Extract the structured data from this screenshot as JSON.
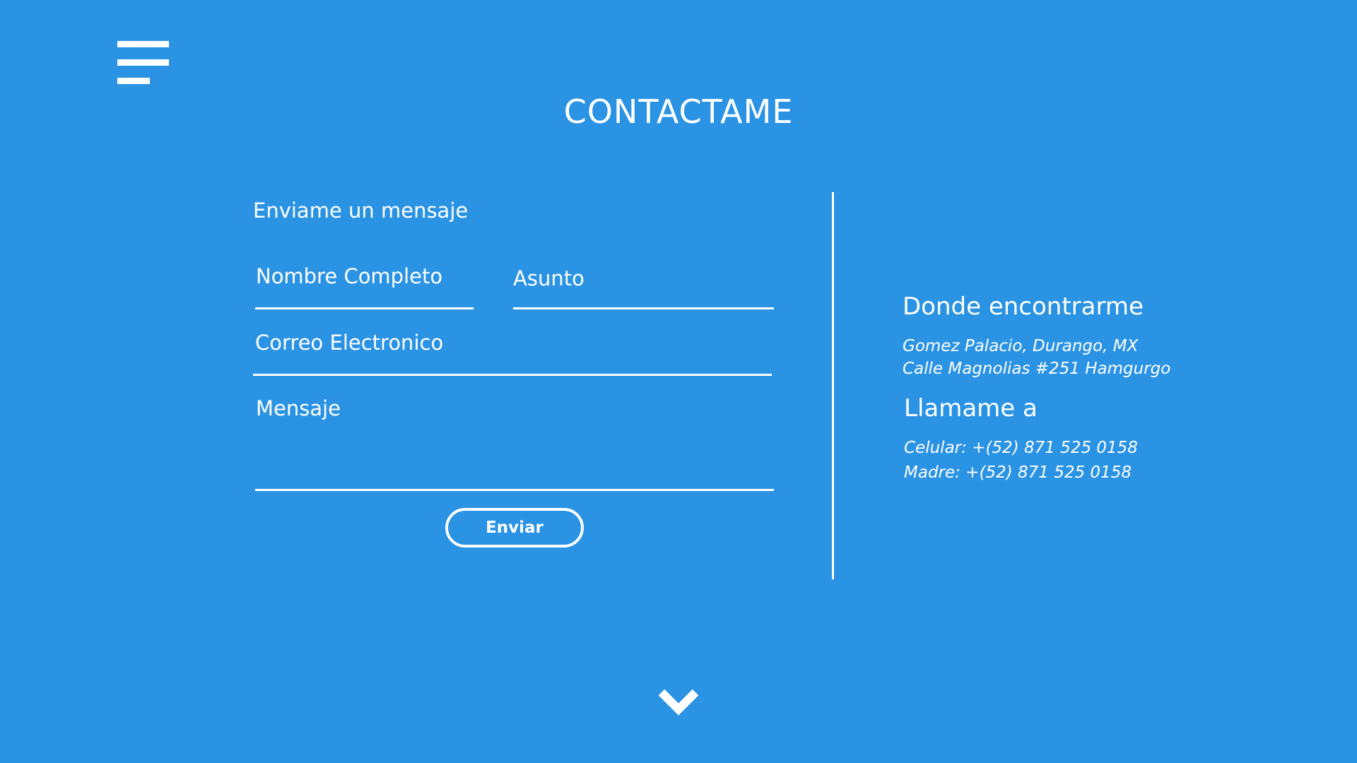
{
  "header": {
    "title": "CONTACTAME",
    "menu_icon": "hamburger-menu-icon"
  },
  "form": {
    "section_title": "Enviame un mensaje",
    "fields": {
      "full_name": {
        "placeholder": "Nombre Completo",
        "value": ""
      },
      "subject": {
        "placeholder": "Asunto",
        "value": ""
      },
      "email": {
        "placeholder": "Correo Electronico",
        "value": ""
      },
      "message": {
        "placeholder": "Mensaje",
        "value": ""
      }
    },
    "submit_label": "Enviar"
  },
  "info": {
    "location_heading": "Donde encontrarme",
    "location_lines": [
      "Gomez Palacio, Durango, MX",
      "Calle Magnolias #251 Hamgurgo"
    ],
    "phone_heading": "Llamame a",
    "phone_lines": [
      "Celular: +(52) 871 525 0158",
      "Madre: +(52) 871 525 0158"
    ]
  },
  "footer": {
    "scroll_icon": "chevron-down-icon"
  },
  "colors": {
    "background": "#2b93e4",
    "foreground": "#ffffff"
  }
}
